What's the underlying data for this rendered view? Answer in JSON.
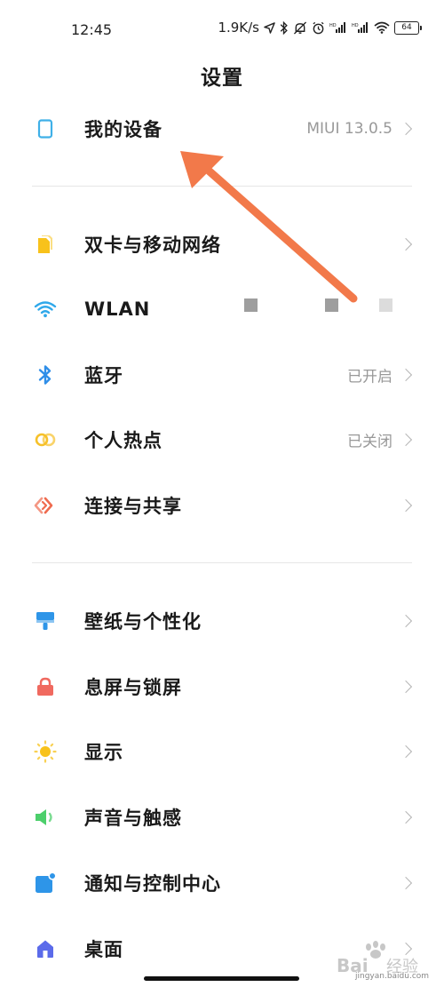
{
  "status_bar": {
    "time": "12:45",
    "net_speed": "1.9K/s",
    "battery": "64"
  },
  "page": {
    "title": "设置"
  },
  "rows": {
    "my_device": {
      "label": "我的设备",
      "value": "MIUI 13.0.5",
      "icon": "phone-outline-icon",
      "icon_color": "#3fb0e8"
    },
    "dual_sim": {
      "label": "双卡与移动网络",
      "value": "",
      "icon": "sim-card-icon",
      "icon_color": "#f8c21b"
    },
    "wlan": {
      "label": "WLAN",
      "value": "",
      "icon": "wifi-icon",
      "icon_color": "#2fa8ea"
    },
    "bluetooth": {
      "label": "蓝牙",
      "value": "已开启",
      "icon": "bluetooth-icon",
      "icon_color": "#2f8ee8"
    },
    "hotspot": {
      "label": "个人热点",
      "value": "已关闭",
      "icon": "hotspot-icon",
      "icon_color": "#f6c12a"
    },
    "connection_sharing": {
      "label": "连接与共享",
      "value": "",
      "icon": "connection-share-icon",
      "icon_color": "#ef6b4f"
    },
    "wallpaper": {
      "label": "壁纸与个性化",
      "value": "",
      "icon": "paint-brush-icon",
      "icon_color": "#2e95e8"
    },
    "lock_screen": {
      "label": "息屏与锁屏",
      "value": "",
      "icon": "lock-icon",
      "icon_color": "#f0695f"
    },
    "display": {
      "label": "显示",
      "value": "",
      "icon": "sun-icon",
      "icon_color": "#f8c21b"
    },
    "sound": {
      "label": "声音与触感",
      "value": "",
      "icon": "speaker-icon",
      "icon_color": "#4ccf6b"
    },
    "notifications": {
      "label": "通知与控制中心",
      "value": "",
      "icon": "notification-icon",
      "icon_color": "#2e95e8"
    },
    "home_screen": {
      "label": "桌面",
      "value": "",
      "icon": "home-icon",
      "icon_color": "#5b6bea"
    }
  },
  "annotation": {
    "arrow_color": "#f2794a"
  },
  "watermark": {
    "text": "jingyan.baidu.com",
    "logo_text": "Bai",
    "logo_suffix": "经验"
  }
}
